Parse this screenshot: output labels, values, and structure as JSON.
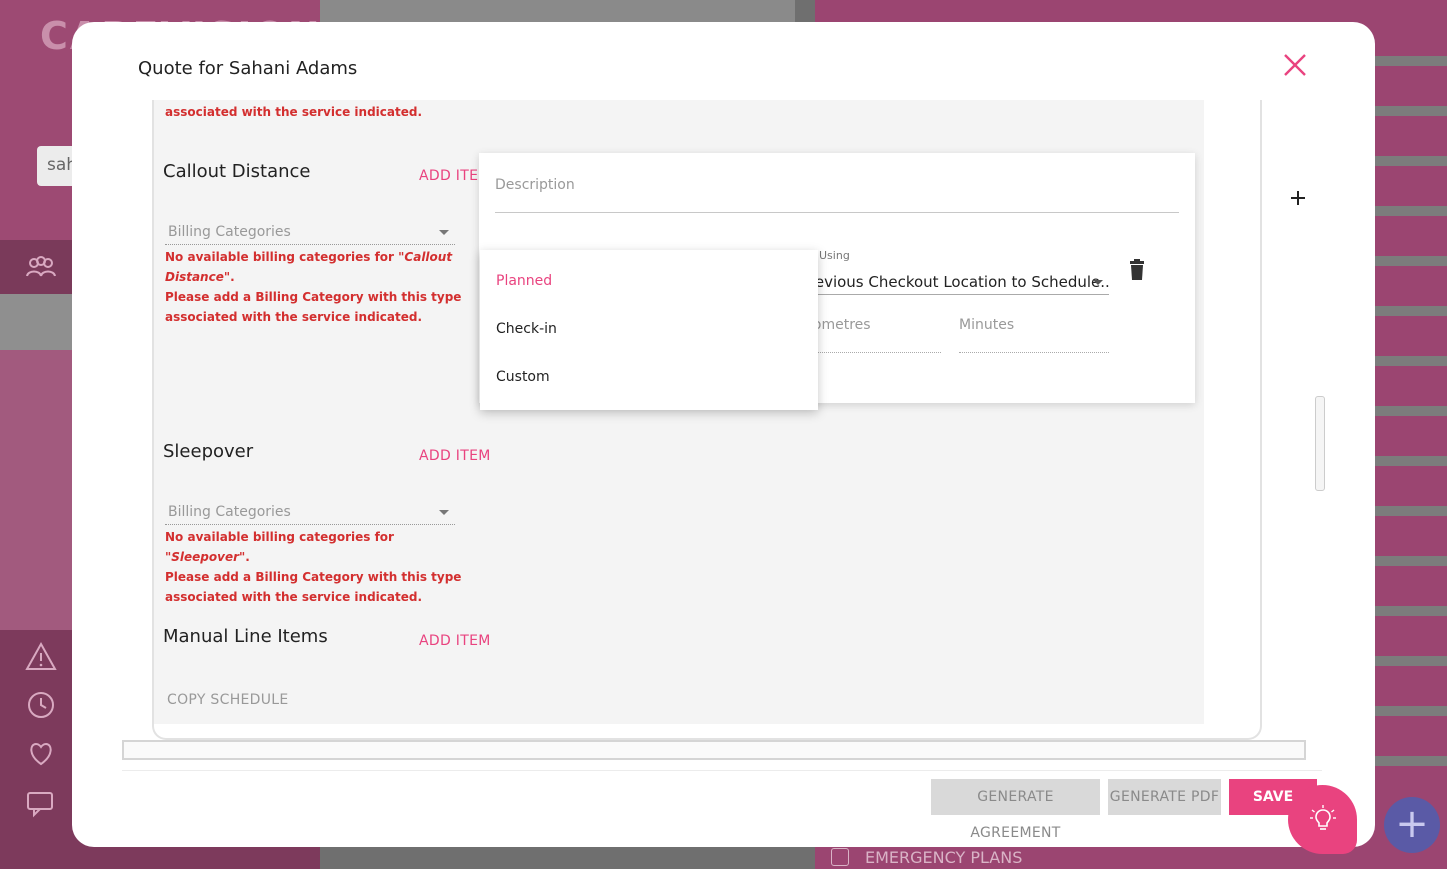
{
  "background": {
    "logo_text": "CAREVISION",
    "search_text": "sah",
    "emergency_plans": "EMERGENCY PLANS"
  },
  "modal": {
    "title": "Quote for Sahani Adams",
    "close_icon": "close-icon"
  },
  "sections": {
    "top_error_tail": "associated with the service indicated.",
    "callout": {
      "title": "Callout Distance",
      "add_item": "ADD ITEM",
      "billing_placeholder": "Billing Categories",
      "error_line1_prefix": "No available billing categories for ",
      "error_line1_value": "\"Callout Distance\"",
      "error_line1_suffix": ".",
      "error_line2": "Please add a Billing Category with this type",
      "error_line3": "associated with the service indicated."
    },
    "sleepover": {
      "title": "Sleepover",
      "add_item": "ADD ITEM",
      "billing_placeholder": "Billing Categories",
      "error_line1_prefix": "No available billing categories for ",
      "error_line1_value": "\"Sleepover\"",
      "error_line1_suffix": ".",
      "error_line2": "Please add a Billing Category with this type",
      "error_line3": "associated with the service indicated."
    },
    "manual": {
      "title": "Manual Line Items",
      "add_item": "ADD ITEM"
    },
    "copy_schedule": "COPY SCHEDULE"
  },
  "card": {
    "description_placeholder": "Description",
    "calc_label": "y Using",
    "calc_value": "revious Checkout Location to Schedule...",
    "kilometres_placeholder": "lometres",
    "minutes_placeholder": "Minutes"
  },
  "dropdown": {
    "options": [
      "Planned",
      "Check-in",
      "Custom"
    ],
    "selected": "Planned"
  },
  "footer": {
    "generate_agreement": "GENERATE AGREEMENT",
    "generate_pdf": "GENERATE PDF",
    "save": "SAVE"
  },
  "colors": {
    "accent": "#e9437f",
    "error": "#d32f2f"
  }
}
